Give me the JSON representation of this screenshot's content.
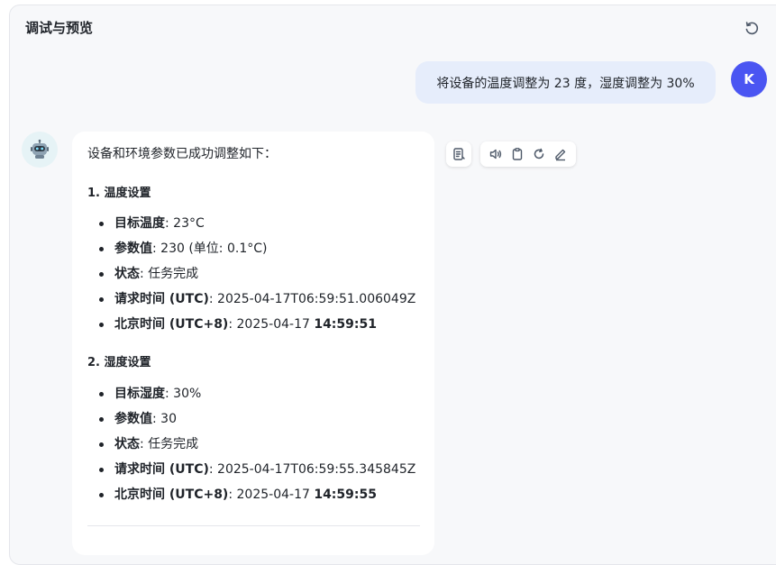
{
  "header": {
    "title": "调试与预览"
  },
  "user_message": {
    "text": "将设备的温度调整为 23 度，湿度调整为 30%",
    "avatar_letter": "K"
  },
  "bot_message": {
    "intro": "设备和环境参数已成功调整如下：",
    "sections": [
      {
        "heading": "1. 温度设置",
        "items": [
          {
            "key": "目标温度",
            "sep": ": ",
            "value": "23°C",
            "bold_value": ""
          },
          {
            "key": "参数值",
            "sep": ": ",
            "value": "230 (单位: 0.1°C)",
            "bold_value": ""
          },
          {
            "key": "状态",
            "sep": ": ",
            "value": "任务完成",
            "bold_value": ""
          },
          {
            "key": "请求时间 (UTC)",
            "sep": ": ",
            "value": "2025-04-17T06:59:51.006049Z",
            "bold_value": ""
          },
          {
            "key": "北京时间 (UTC+8)",
            "sep": ": ",
            "value": "2025-04-17 ",
            "bold_value": "14:59:51"
          }
        ]
      },
      {
        "heading": "2. 湿度设置",
        "items": [
          {
            "key": "目标湿度",
            "sep": ": ",
            "value": "30%",
            "bold_value": ""
          },
          {
            "key": "参数值",
            "sep": ": ",
            "value": "30",
            "bold_value": ""
          },
          {
            "key": "状态",
            "sep": ": ",
            "value": "任务完成",
            "bold_value": ""
          },
          {
            "key": "请求时间 (UTC)",
            "sep": ": ",
            "value": "2025-04-17T06:59:55.345845Z",
            "bold_value": ""
          },
          {
            "key": "北京时间 (UTC+8)",
            "sep": ": ",
            "value": "2025-04-17 ",
            "bold_value": "14:59:55"
          }
        ]
      }
    ]
  },
  "icons": {
    "header": "refresh-icon",
    "toolbar": [
      "document-icon",
      "speaker-icon",
      "clipboard-icon",
      "regenerate-icon",
      "edit-icon"
    ]
  },
  "colors": {
    "accent": "#4a55f2",
    "user_bubble": "#e6edfb",
    "panel_bg": "#f7f8fa"
  }
}
